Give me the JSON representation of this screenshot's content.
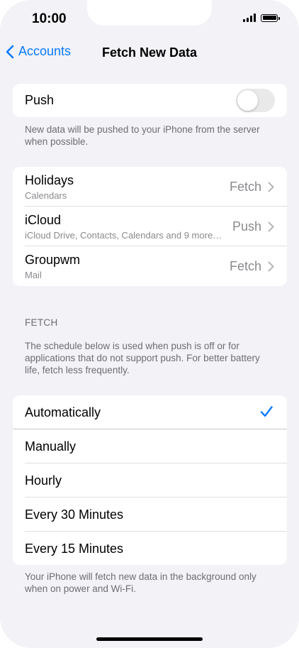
{
  "status": {
    "time": "10:00"
  },
  "nav": {
    "back_label": "Accounts",
    "title": "Fetch New Data"
  },
  "push": {
    "label": "Push",
    "enabled": false,
    "footnote": "New data will be pushed to your iPhone from the server when possible."
  },
  "accounts": [
    {
      "title": "Holidays",
      "subtitle": "Calendars",
      "value": "Fetch"
    },
    {
      "title": "iCloud",
      "subtitle": "iCloud Drive, Contacts, Calendars and 9 more…",
      "value": "Push"
    },
    {
      "title": "Groupwm",
      "subtitle": "Mail",
      "value": "Fetch"
    }
  ],
  "fetch": {
    "header": "FETCH",
    "description": "The schedule below is used when push is off or for applications that do not support push. For better battery life, fetch less frequently.",
    "options": [
      {
        "label": "Automatically",
        "selected": true
      },
      {
        "label": "Manually",
        "selected": false
      },
      {
        "label": "Hourly",
        "selected": false
      },
      {
        "label": "Every 30 Minutes",
        "selected": false
      },
      {
        "label": "Every 15 Minutes",
        "selected": false
      }
    ],
    "footnote": "Your iPhone will fetch new data in the background only when on power and Wi-Fi."
  },
  "colors": {
    "accent": "#0a7aff",
    "background": "#f2f2f7",
    "secondary_text": "#8a8a8e"
  }
}
